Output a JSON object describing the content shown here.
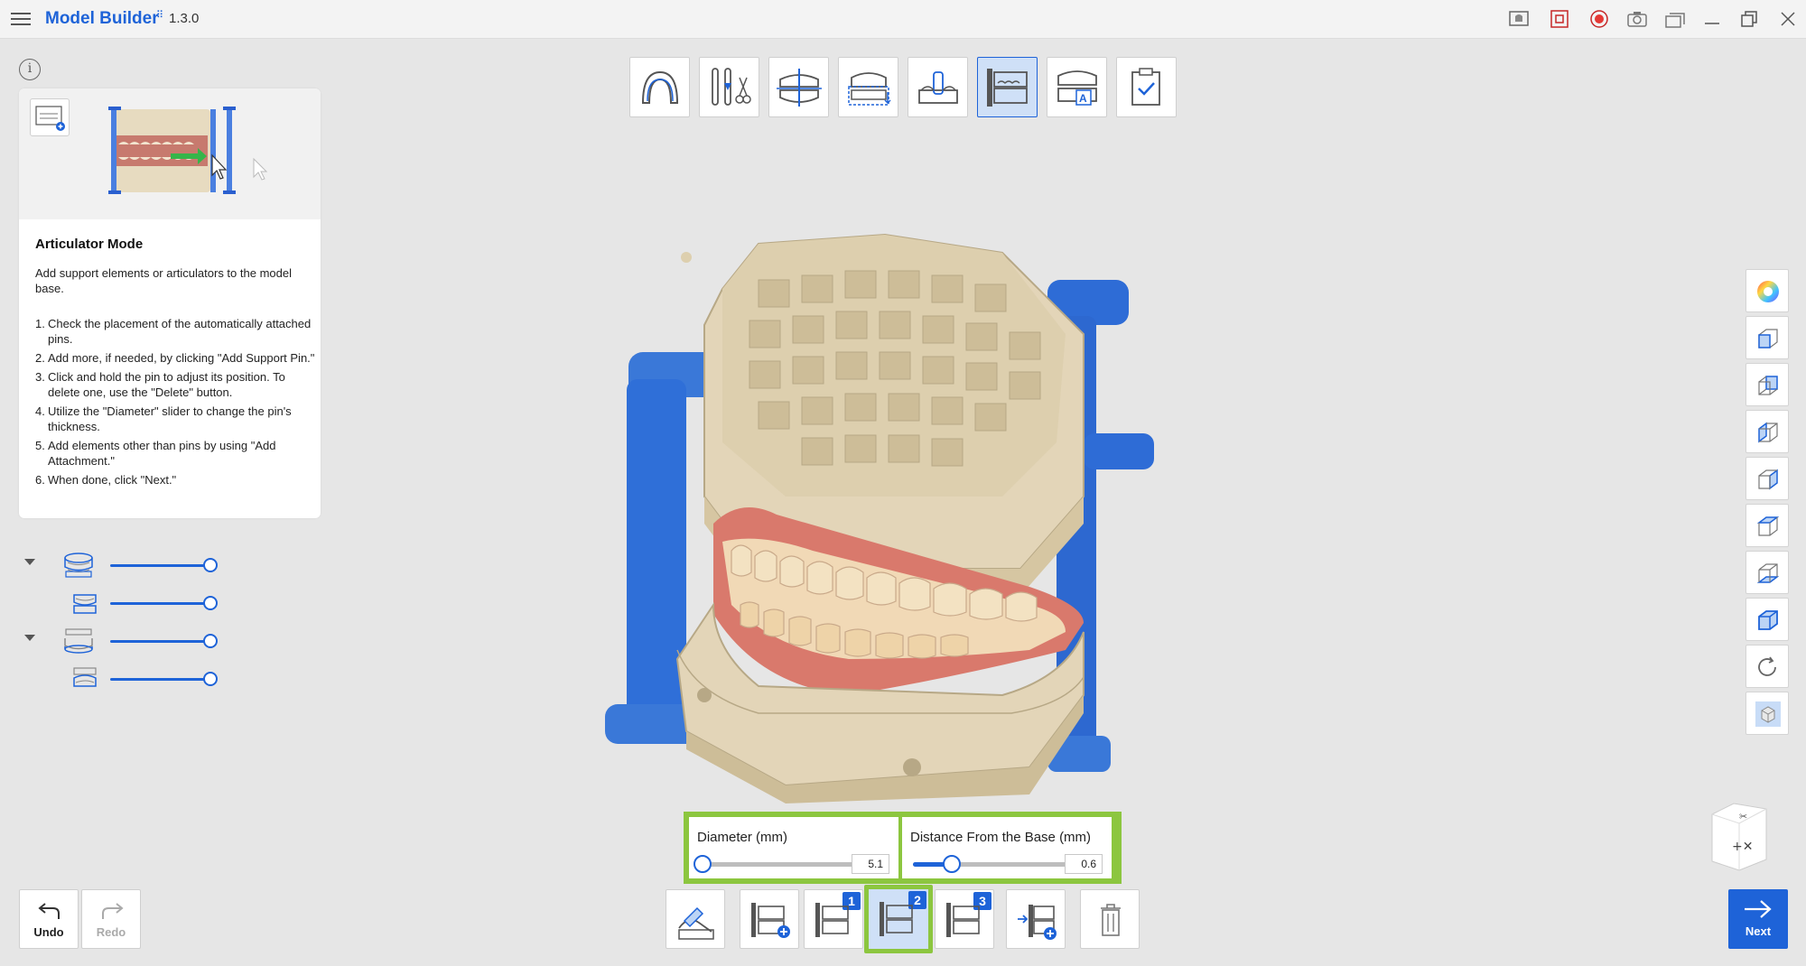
{
  "app": {
    "title": "Model Builder",
    "badge": "⠿",
    "version": "1.3.0"
  },
  "help": {
    "title": "Articulator Mode",
    "description": "Add support elements or articulators to the model base.",
    "steps": [
      {
        "num": "1.",
        "text": "Check the placement of the automatically attached pins."
      },
      {
        "num": "2.",
        "text": "Add more, if needed, by clicking \"Add Support Pin.\""
      },
      {
        "num": "3.",
        "text": "Click and hold the pin to adjust its position. To delete one, use the \"Delete\" button."
      },
      {
        "num": "4.",
        "text": "Utilize the \"Diameter\" slider to change the pin's thickness."
      },
      {
        "num": "5.",
        "text": "Add elements other than pins by using \"Add Attachment.\""
      },
      {
        "num": "6.",
        "text": "When done, click \"Next.\""
      }
    ]
  },
  "layers": [
    {
      "name": "upper-jaw-base",
      "opacity": 1.0
    },
    {
      "name": "upper-jaw-scan",
      "opacity": 1.0
    },
    {
      "name": "lower-jaw-base",
      "opacity": 1.0
    },
    {
      "name": "lower-jaw-scan",
      "opacity": 1.0
    }
  ],
  "params": {
    "diameter": {
      "label": "Diameter (mm)",
      "value": "5.1",
      "fraction": 0.02
    },
    "distance": {
      "label": "Distance From the Base (mm)",
      "value": "0.6",
      "fraction": 0.25
    }
  },
  "bottom_tools": {
    "badges": [
      "1",
      "2",
      "3"
    ],
    "undo_label": "Undo",
    "redo_label": "Redo",
    "next_label": "Next"
  },
  "colors": {
    "accent": "#1e63d8",
    "highlight": "#8cc63f",
    "model_base": "#e3d5b8",
    "articulator": "#3a78d8",
    "gum": "#d9796c"
  }
}
